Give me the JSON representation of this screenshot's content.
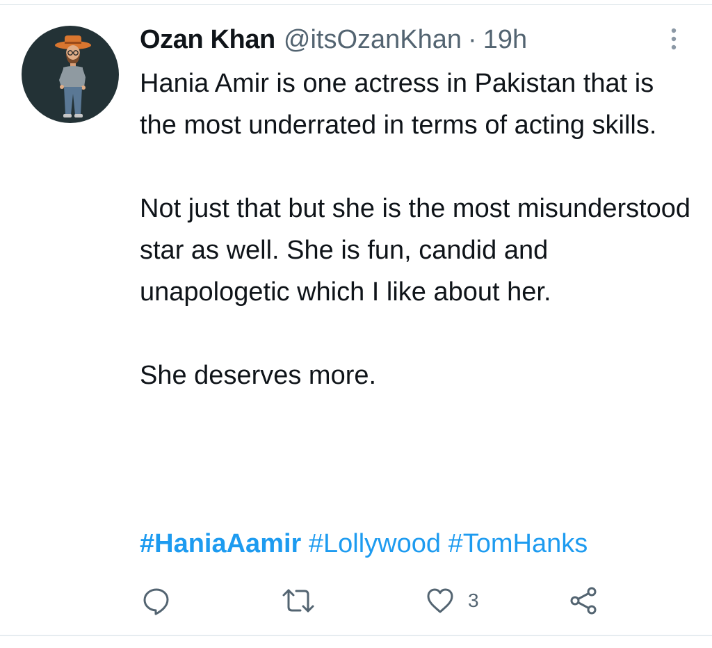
{
  "tweet": {
    "author": {
      "display_name": "Ozan Khan",
      "handle": "@itsOzanKhan",
      "separator": "·",
      "time": "19h"
    },
    "paragraphs": [
      "Hania Amir is one actress in Pakistan that is the most underrated in terms of acting skills.",
      "Not just that but she is the most misunderstood star as well. She is fun, candid and unapologetic which I like about her.",
      "She deserves more."
    ],
    "hashtags": [
      "#HaniaAamir",
      "#Lollywood",
      "#TomHanks"
    ],
    "actions": {
      "reply_icon": "speech-bubble",
      "retweet_icon": "retweet-arrows",
      "like_icon": "heart",
      "like_count": "3",
      "share_icon": "share-nodes"
    }
  },
  "colors": {
    "text": "#0f1419",
    "secondary": "#536471",
    "link": "#1d9bf0",
    "avatar_bg": "#233236"
  }
}
